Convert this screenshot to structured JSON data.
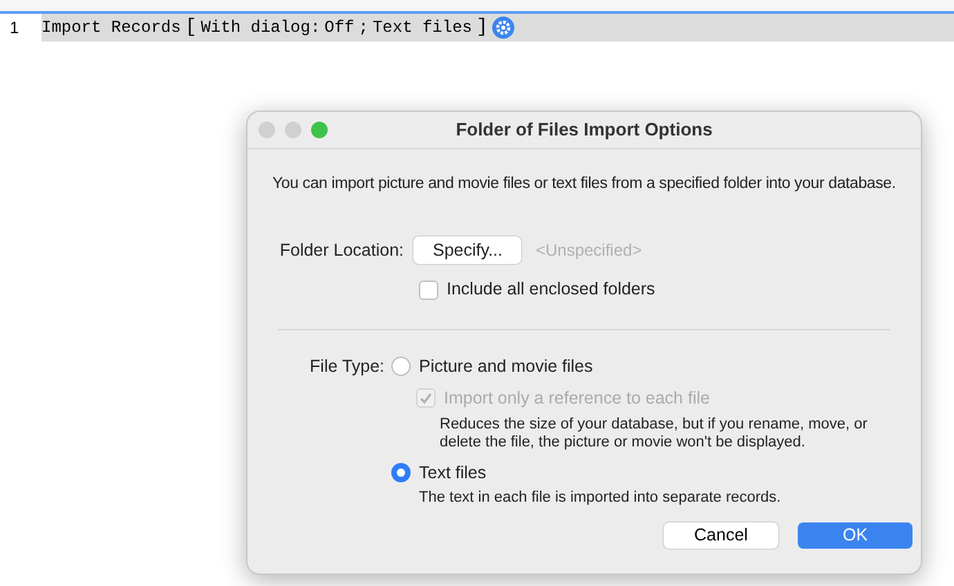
{
  "script": {
    "line_number": "1",
    "parts": [
      {
        "kind": "keyword",
        "text": "Import Records"
      },
      {
        "kind": "bracket",
        "text": "["
      },
      {
        "kind": "keyword",
        "text": "With dialog:"
      },
      {
        "kind": "keyword",
        "text": "Off"
      },
      {
        "kind": "keyword",
        "text": ";"
      },
      {
        "kind": "keyword",
        "text": "Text files"
      },
      {
        "kind": "bracket",
        "text": "]"
      },
      {
        "kind": "gear"
      }
    ]
  },
  "dialog": {
    "title": "Folder of Files Import Options",
    "intro": "You can import picture and movie files or text files from a specified folder into your database.",
    "folder_location": {
      "label": "Folder Location:",
      "button": "Specify...",
      "value": "<Unspecified>"
    },
    "include_subfolders": {
      "label": "Include all enclosed folders",
      "checked": false
    },
    "file_type": {
      "label": "File Type:",
      "options": [
        {
          "label": "Picture and movie files",
          "selected": false,
          "suboption": {
            "label": "Import only a reference to each file",
            "checked": true,
            "disabled": true
          },
          "description": "Reduces the size of your database, but if you rename, move, or delete the file, the picture or movie won't be displayed."
        },
        {
          "label": "Text files",
          "selected": true,
          "description": "The text in each file is imported into separate records."
        }
      ]
    },
    "buttons": [
      {
        "label": "Cancel",
        "kind": "secondary"
      },
      {
        "label": "OK",
        "kind": "primary"
      }
    ]
  }
}
